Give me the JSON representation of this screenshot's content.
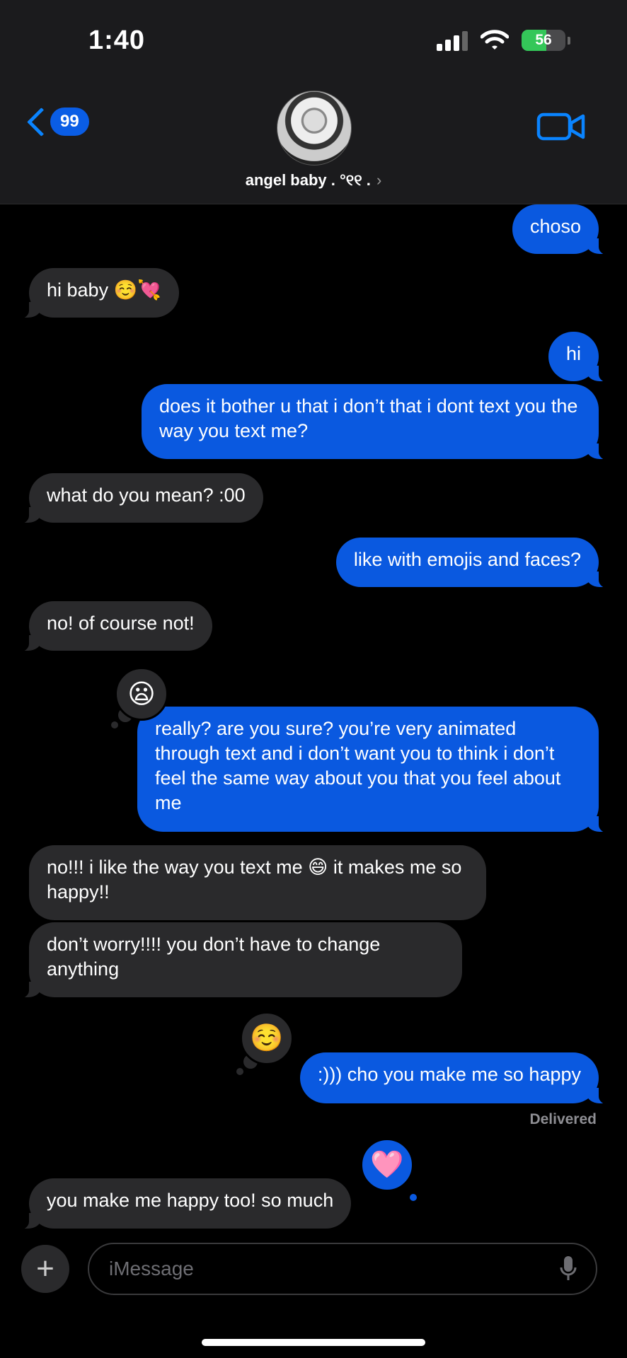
{
  "status": {
    "time": "1:40",
    "battery": "56",
    "battery_fraction": 0.56
  },
  "header": {
    "unread_count": "99",
    "contact_name": "angel baby . °୧୧ .",
    "contact_chevron": "›"
  },
  "messages": [
    {
      "from": "me",
      "text": "choso"
    },
    {
      "from": "them",
      "text": "hi baby ☺️💘"
    },
    {
      "from": "me",
      "text": "hi"
    },
    {
      "from": "me",
      "text": "does it bother u that i don’t that i dont text you the way you text me?"
    },
    {
      "from": "them",
      "text": "what do you mean? :00"
    },
    {
      "from": "me",
      "text": "like with emojis and faces?"
    },
    {
      "from": "them",
      "text": "no! of course not!"
    },
    {
      "from": "me",
      "text": "really? are you sure? you’re very animated through text and i don’t want you to think i don’t feel the same way about you that you feel about me",
      "reaction": "😦"
    },
    {
      "from": "them",
      "text": "no!!! i like the way you text me 😄 it makes me so happy!!"
    },
    {
      "from": "them",
      "text": "don’t worry!!!! you don’t have to change anything"
    },
    {
      "from": "me",
      "text": ":))) cho you make me so happy",
      "reaction": "☺️"
    },
    {
      "from": "them",
      "text": "you make me happy too! so much",
      "reaction": "🩷"
    }
  ],
  "delivered_label": "Delivered",
  "compose": {
    "plus": "+",
    "placeholder": "iMessage"
  },
  "colors": {
    "outgoing": "#0a59e0",
    "incoming": "#2a2a2c",
    "accent": "#0a84ff"
  }
}
